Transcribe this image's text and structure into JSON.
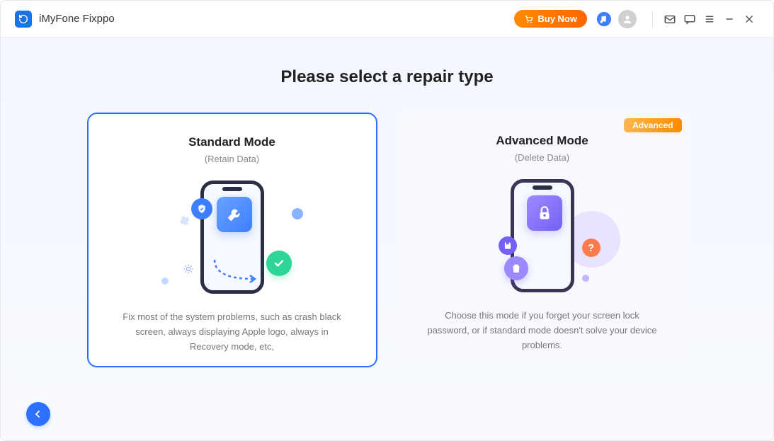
{
  "header": {
    "app_name": "iMyFone Fixppo",
    "buy_now_label": "Buy Now"
  },
  "main": {
    "heading": "Please select a repair type"
  },
  "cards": {
    "standard": {
      "title": "Standard Mode",
      "subtitle": "(Retain Data)",
      "desc": "Fix most of the system problems, such as crash black screen, always displaying Apple logo, always in Recovery mode, etc,"
    },
    "advanced": {
      "badge": "Advanced",
      "title": "Advanced Mode",
      "subtitle": "(Delete Data)",
      "desc": "Choose this mode if you forget your screen lock password, or if standard mode doesn't solve your device problems."
    }
  },
  "icons": {
    "question": "?"
  }
}
